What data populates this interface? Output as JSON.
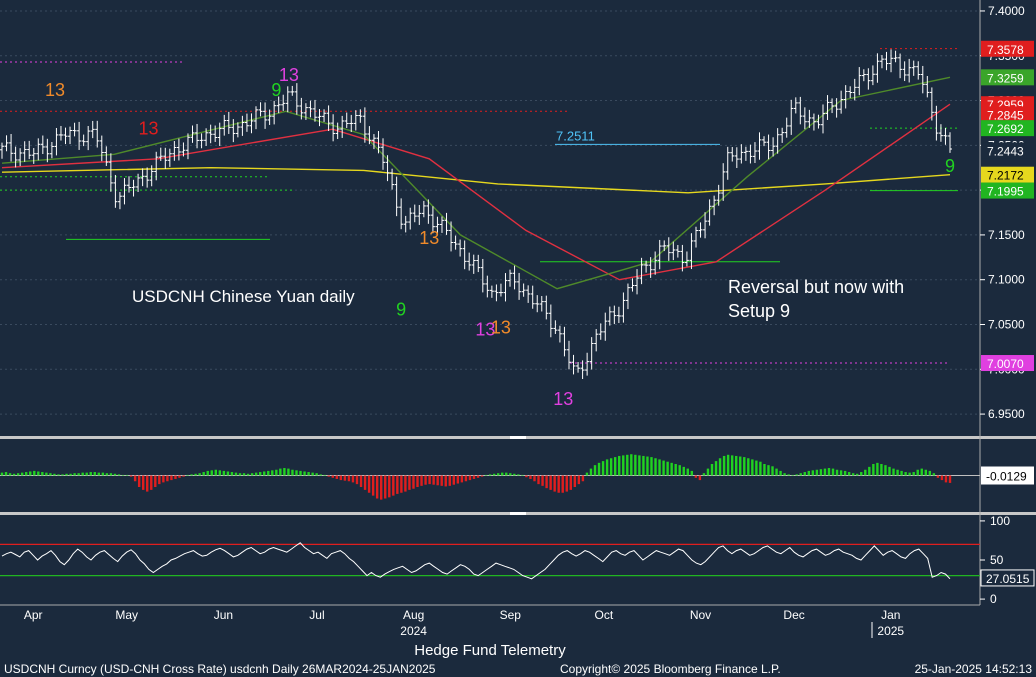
{
  "chart_data": [
    {
      "type": "candlestick",
      "panel": "price",
      "ticker_label": "USDCNH Chinese Yuan daily",
      "annotation": "Reversal but now with Setup 9",
      "ylim": [
        6.93,
        7.41
      ],
      "y_ticks": [
        "7.4000",
        "7.3500",
        "7.3000",
        "7.2500",
        "7.2000",
        "7.1500",
        "7.1000",
        "7.0500",
        "7.0000",
        "6.9500"
      ],
      "y_tick_values": [
        7.4,
        7.35,
        7.3,
        7.25,
        7.2,
        7.15,
        7.1,
        7.05,
        7.0,
        6.95
      ],
      "price_labels": [
        {
          "text": "7.3578",
          "value": 7.3578,
          "color": "#e01e1e"
        },
        {
          "text": "7.3259",
          "value": 7.3259,
          "color": "#3aa52a"
        },
        {
          "text": "7.2959",
          "value": 7.2959,
          "color": "#e01e1e"
        },
        {
          "text": "7.2845",
          "value": 7.2845,
          "color": "#e01e1e"
        },
        {
          "text": "7.2692",
          "value": 7.2692,
          "color": "#21b521"
        },
        {
          "text": "7.2443",
          "value": 7.2443,
          "color": "#ffffff"
        },
        {
          "text": "7.2172",
          "value": 7.2172,
          "color": "#e6d81e"
        },
        {
          "text": "7.1995",
          "value": 7.1995,
          "color": "#21b521"
        },
        {
          "text": "7.0070",
          "value": 7.007,
          "color": "#e040e0"
        }
      ],
      "level_labels": [
        {
          "text": "7.2511",
          "value": 7.2511,
          "color": "#4fc3f7"
        }
      ],
      "close_series": [
        {
          "date": "2024-03-26",
          "close": 7.245
        },
        {
          "date": "2024-04-05",
          "close": 7.24
        },
        {
          "date": "2024-04-15",
          "close": 7.262
        },
        {
          "date": "2024-04-25",
          "close": 7.262
        },
        {
          "date": "2024-05-02",
          "close": 7.19
        },
        {
          "date": "2024-05-10",
          "close": 7.215
        },
        {
          "date": "2024-05-20",
          "close": 7.245
        },
        {
          "date": "2024-05-30",
          "close": 7.262
        },
        {
          "date": "2024-06-10",
          "close": 7.272
        },
        {
          "date": "2024-06-20",
          "close": 7.288
        },
        {
          "date": "2024-06-26",
          "close": 7.305
        },
        {
          "date": "2024-07-05",
          "close": 7.282
        },
        {
          "date": "2024-07-12",
          "close": 7.27
        },
        {
          "date": "2024-07-19",
          "close": 7.28
        },
        {
          "date": "2024-07-26",
          "close": 7.235
        },
        {
          "date": "2024-08-02",
          "close": 7.16
        },
        {
          "date": "2024-08-08",
          "close": 7.18
        },
        {
          "date": "2024-08-16",
          "close": 7.15
        },
        {
          "date": "2024-08-23",
          "close": 7.12
        },
        {
          "date": "2024-08-30",
          "close": 7.085
        },
        {
          "date": "2024-09-06",
          "close": 7.1
        },
        {
          "date": "2024-09-13",
          "close": 7.075
        },
        {
          "date": "2024-09-20",
          "close": 7.045
        },
        {
          "date": "2024-09-26",
          "close": 6.99
        },
        {
          "date": "2024-10-03",
          "close": 7.04
        },
        {
          "date": "2024-10-10",
          "close": 7.07
        },
        {
          "date": "2024-10-17",
          "close": 7.11
        },
        {
          "date": "2024-10-24",
          "close": 7.135
        },
        {
          "date": "2024-10-31",
          "close": 7.125
        },
        {
          "date": "2024-11-07",
          "close": 7.17
        },
        {
          "date": "2024-11-14",
          "close": 7.235
        },
        {
          "date": "2024-11-21",
          "close": 7.245
        },
        {
          "date": "2024-11-28",
          "close": 7.25
        },
        {
          "date": "2024-12-05",
          "close": 7.29
        },
        {
          "date": "2024-12-12",
          "close": 7.275
        },
        {
          "date": "2024-12-19",
          "close": 7.3
        },
        {
          "date": "2024-12-26",
          "close": 7.32
        },
        {
          "date": "2025-01-02",
          "close": 7.345
        },
        {
          "date": "2025-01-08",
          "close": 7.34
        },
        {
          "date": "2025-01-14",
          "close": 7.33
        },
        {
          "date": "2025-01-20",
          "close": 7.27
        },
        {
          "date": "2025-01-24",
          "close": 7.244
        }
      ],
      "moving_averages": [
        {
          "color": "#e6d81e",
          "values": [
            {
              "date": "2024-03-26",
              "v": 7.22
            },
            {
              "date": "2024-06-01",
              "v": 7.225
            },
            {
              "date": "2024-07-20",
              "v": 7.222
            },
            {
              "date": "2024-09-01",
              "v": 7.207
            },
            {
              "date": "2024-11-01",
              "v": 7.197
            },
            {
              "date": "2024-12-15",
              "v": 7.207
            },
            {
              "date": "2025-01-24",
              "v": 7.2172
            }
          ]
        },
        {
          "color": "#e03040",
          "values": [
            {
              "date": "2024-03-26",
              "v": 7.225
            },
            {
              "date": "2024-05-15",
              "v": 7.235
            },
            {
              "date": "2024-07-10",
              "v": 7.268
            },
            {
              "date": "2024-08-10",
              "v": 7.235
            },
            {
              "date": "2024-09-10",
              "v": 7.155
            },
            {
              "date": "2024-10-10",
              "v": 7.1
            },
            {
              "date": "2024-11-10",
              "v": 7.12
            },
            {
              "date": "2024-12-15",
              "v": 7.2
            },
            {
              "date": "2025-01-24",
              "v": 7.2959
            }
          ]
        },
        {
          "color": "#4f8a2a",
          "values": [
            {
              "date": "2024-03-26",
              "v": 7.23
            },
            {
              "date": "2024-05-01",
              "v": 7.24
            },
            {
              "date": "2024-06-25",
              "v": 7.288
            },
            {
              "date": "2024-07-20",
              "v": 7.262
            },
            {
              "date": "2024-08-20",
              "v": 7.15
            },
            {
              "date": "2024-09-20",
              "v": 7.09
            },
            {
              "date": "2024-10-20",
              "v": 7.12
            },
            {
              "date": "2024-11-20",
              "v": 7.215
            },
            {
              "date": "2024-12-20",
              "v": 7.3
            },
            {
              "date": "2025-01-24",
              "v": 7.3259
            }
          ]
        }
      ],
      "td_labels": [
        {
          "text": "13",
          "date": "2024-04-12",
          "v": 7.305,
          "color": "#f08a2a"
        },
        {
          "text": "13",
          "date": "2024-05-12",
          "v": 7.262,
          "color": "#e01e1e"
        },
        {
          "text": "13",
          "date": "2024-06-26",
          "v": 7.322,
          "color": "#e040e0"
        },
        {
          "text": "9",
          "date": "2024-06-22",
          "v": 7.305,
          "color": "#21d221"
        },
        {
          "text": "9",
          "date": "2024-08-01",
          "v": 7.06,
          "color": "#21d221"
        },
        {
          "text": "13",
          "date": "2024-08-10",
          "v": 7.14,
          "color": "#f08a2a"
        },
        {
          "text": "13",
          "date": "2024-08-28",
          "v": 7.038,
          "color": "#e040e0"
        },
        {
          "text": "13",
          "date": "2024-09-02",
          "v": 7.04,
          "color": "#f08a2a"
        },
        {
          "text": "13",
          "date": "2024-09-22",
          "v": 6.96,
          "color": "#e040e0"
        },
        {
          "text": "9",
          "date": "2025-01-24",
          "v": 7.22,
          "color": "#21d221"
        }
      ]
    },
    {
      "type": "histogram",
      "panel": "momentum",
      "zero_line": true,
      "last_value": {
        "text": "-0.0129",
        "value": -0.0129
      },
      "ylim": [
        -0.06,
        0.06
      ],
      "values": [
        0.005,
        0.006,
        0.004,
        0.003,
        0.004,
        0.005,
        0.006,
        0.007,
        0.008,
        0.007,
        0.006,
        0.005,
        0.004,
        0.003,
        0.002,
        0.002,
        0.003,
        0.003,
        0.004,
        0.004,
        0.005,
        0.005,
        0.006,
        0.006,
        0.005,
        0.005,
        0.004,
        0.004,
        0.003,
        0.002,
        0.001,
        0.001,
        -0.002,
        -0.01,
        -0.02,
        -0.025,
        -0.028,
        -0.025,
        -0.02,
        -0.015,
        -0.012,
        -0.01,
        -0.008,
        -0.006,
        -0.004,
        -0.002,
        0.001,
        0.002,
        0.003,
        0.004,
        0.006,
        0.008,
        0.009,
        0.01,
        0.009,
        0.008,
        0.007,
        0.006,
        0.005,
        0.004,
        0.004,
        0.003,
        0.004,
        0.005,
        0.006,
        0.007,
        0.008,
        0.009,
        0.01,
        0.012,
        0.013,
        0.012,
        0.01,
        0.009,
        0.008,
        0.007,
        0.006,
        0.005,
        0.004,
        0.002,
        0.001,
        -0.002,
        -0.004,
        -0.006,
        -0.008,
        -0.009,
        -0.01,
        -0.012,
        -0.015,
        -0.02,
        -0.025,
        -0.03,
        -0.035,
        -0.04,
        -0.042,
        -0.04,
        -0.038,
        -0.035,
        -0.032,
        -0.03,
        -0.028,
        -0.025,
        -0.023,
        -0.02,
        -0.018,
        -0.016,
        -0.015,
        -0.016,
        -0.017,
        -0.018,
        -0.019,
        -0.018,
        -0.016,
        -0.014,
        -0.012,
        -0.01,
        -0.008,
        -0.006,
        -0.004,
        -0.002,
        0.001,
        0.002,
        0.003,
        0.004,
        0.005,
        0.005,
        0.004,
        0.003,
        0.002,
        0.001,
        -0.003,
        -0.006,
        -0.01,
        -0.015,
        -0.018,
        -0.022,
        -0.025,
        -0.028,
        -0.03,
        -0.03,
        -0.028,
        -0.025,
        -0.02,
        -0.015,
        -0.01,
        0.005,
        0.012,
        0.018,
        0.022,
        0.025,
        0.028,
        0.03,
        0.032,
        0.034,
        0.035,
        0.036,
        0.037,
        0.036,
        0.035,
        0.034,
        0.033,
        0.032,
        0.03,
        0.028,
        0.026,
        0.024,
        0.022,
        0.02,
        0.018,
        0.015,
        0.012,
        0.008,
        -0.004,
        -0.008,
        0.004,
        0.012,
        0.02,
        0.025,
        0.03,
        0.034,
        0.036,
        0.035,
        0.034,
        0.033,
        0.032,
        0.03,
        0.028,
        0.026,
        0.024,
        0.02,
        0.018,
        0.016,
        0.012,
        0.008,
        0.004,
        0.002,
        0.001,
        0.002,
        0.004,
        0.006,
        0.008,
        0.009,
        0.01,
        0.011,
        0.012,
        0.013,
        0.012,
        0.01,
        0.009,
        0.008,
        0.006,
        0.004,
        0.003,
        0.006,
        0.01,
        0.015,
        0.02,
        0.022,
        0.02,
        0.018,
        0.015,
        0.012,
        0.01,
        0.008,
        0.006,
        0.005,
        0.006,
        0.01,
        0.012,
        0.01,
        0.008,
        0.004,
        -0.004,
        -0.008,
        -0.012,
        -0.0129
      ]
    },
    {
      "type": "line",
      "panel": "rsi",
      "ylim": [
        -5,
        105
      ],
      "y_ticks": [
        "100",
        "50",
        "0"
      ],
      "y_tick_values": [
        100,
        50,
        0
      ],
      "bands": [
        {
          "value": 70,
          "color": "#e01e1e"
        },
        {
          "value": 30,
          "color": "#21b521"
        }
      ],
      "last_value": {
        "text": "27.0515",
        "value": 27.0515
      },
      "values": [
        55,
        58,
        60,
        57,
        54,
        60,
        62,
        56,
        50,
        55,
        58,
        62,
        56,
        48,
        44,
        50,
        58,
        64,
        60,
        54,
        50,
        56,
        60,
        62,
        57,
        52,
        48,
        55,
        60,
        63,
        58,
        50,
        45,
        38,
        34,
        38,
        42,
        45,
        50,
        52,
        55,
        58,
        60,
        62,
        58,
        55,
        56,
        60,
        63,
        65,
        62,
        58,
        54,
        56,
        60,
        64,
        66,
        62,
        58,
        60,
        64,
        66,
        64,
        62,
        60,
        64,
        68,
        72,
        66,
        62,
        58,
        60,
        56,
        52,
        58,
        60,
        62,
        58,
        52,
        48,
        42,
        36,
        30,
        34,
        30,
        28,
        32,
        35,
        38,
        40,
        42,
        38,
        34,
        36,
        40,
        44,
        46,
        42,
        38,
        34,
        32,
        36,
        40,
        44,
        42,
        38,
        32,
        30,
        34,
        38,
        42,
        46,
        44,
        42,
        40,
        38,
        34,
        30,
        28,
        26,
        30,
        34,
        38,
        44,
        50,
        56,
        60,
        62,
        58,
        55,
        58,
        62,
        60,
        56,
        52,
        48,
        54,
        60,
        62,
        58,
        56,
        60,
        62,
        56,
        50,
        54,
        58,
        62,
        60,
        58,
        56,
        60,
        64,
        62,
        56,
        50,
        46,
        44,
        48,
        54,
        60,
        66,
        68,
        62,
        58,
        62,
        64,
        60,
        56,
        58,
        62,
        66,
        68,
        64,
        60,
        58,
        62,
        66,
        60,
        56,
        54,
        58,
        62,
        64,
        60,
        56,
        58,
        62,
        64,
        60,
        58,
        56,
        52,
        50,
        56,
        62,
        68,
        62,
        56,
        60,
        62,
        58,
        54,
        52,
        58,
        62,
        64,
        58,
        52,
        28,
        30,
        34,
        32,
        26
      ]
    }
  ],
  "x_axis": {
    "months": [
      "Apr",
      "May",
      "Jun",
      "Jul",
      "Aug",
      "Sep",
      "Oct",
      "Nov",
      "Dec",
      "Jan"
    ],
    "month_dates": [
      "2024-04-05",
      "2024-05-05",
      "2024-06-05",
      "2024-07-05",
      "2024-08-05",
      "2024-09-05",
      "2024-10-05",
      "2024-11-05",
      "2024-12-05",
      "2025-01-05"
    ],
    "years": [
      "2024",
      "2025"
    ]
  },
  "footer": {
    "title": "Hedge Fund Telemetry",
    "left": "USDCNH Curncy (USD-CNH Cross Rate) usdcnh  Daily 26MAR2024-25JAN2025",
    "center": "Copyright© 2025 Bloomberg Finance L.P.",
    "right": "25-Jan-2025 14:52:13"
  }
}
